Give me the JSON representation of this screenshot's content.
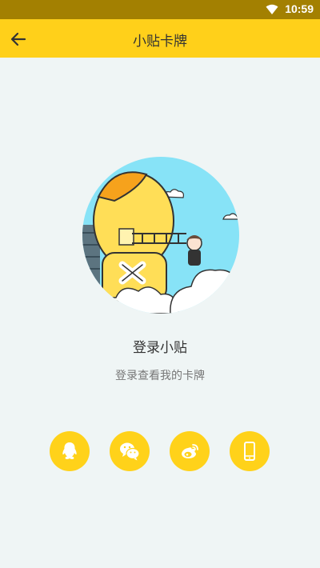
{
  "status_bar": {
    "time": "10:59"
  },
  "app_bar": {
    "title": "小贴卡牌"
  },
  "main": {
    "login_title": "登录小贴",
    "login_subtitle": "登录查看我的卡牌"
  },
  "login_options": [
    {
      "id": "qq",
      "icon": "qq-icon"
    },
    {
      "id": "wechat",
      "icon": "wechat-icon"
    },
    {
      "id": "weibo",
      "icon": "weibo-icon"
    },
    {
      "id": "phone",
      "icon": "phone-icon"
    }
  ],
  "colors": {
    "status_bar": "#a38001",
    "app_bar": "#ffd01a",
    "background": "#eff5f5",
    "login_button": "#ffd21a"
  }
}
